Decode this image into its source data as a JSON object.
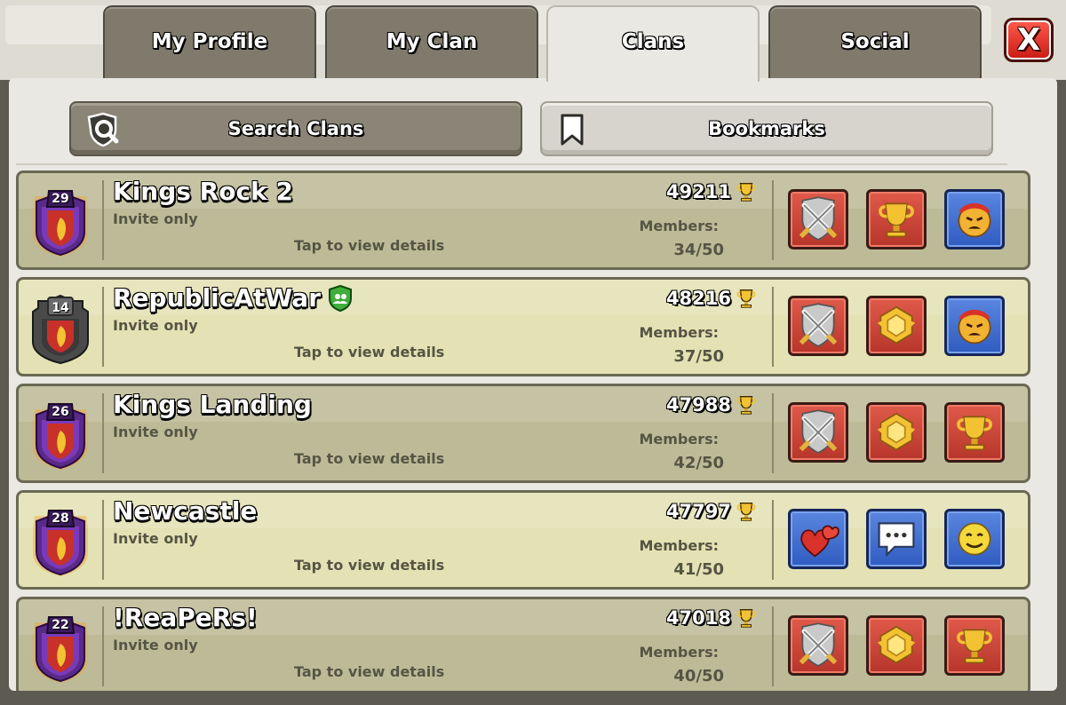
{
  "tabs": [
    {
      "label": "My Profile",
      "active": false
    },
    {
      "label": "My Clan",
      "active": false
    },
    {
      "label": "Clans",
      "active": true
    },
    {
      "label": "Social",
      "active": false
    }
  ],
  "close_label": "X",
  "subnav": {
    "search_label": "Search Clans",
    "bookmarks_label": "Bookmarks"
  },
  "clans": [
    {
      "name": "Kings Rock 2",
      "level": "29",
      "status": "Invite only",
      "details": "Tap to view details",
      "trophies": "49211",
      "members_label": "Members:",
      "members": "34/50",
      "badge_style": "purple",
      "verified": false,
      "labels": [
        {
          "icon": "crossed-swords-icon",
          "color": "red"
        },
        {
          "icon": "trophy-icon",
          "color": "red"
        },
        {
          "icon": "angry-face-icon",
          "color": "blue"
        }
      ]
    },
    {
      "name": "RepublicAtWar",
      "level": "14",
      "status": "Invite only",
      "details": "Tap to view details",
      "trophies": "48216",
      "members_label": "Members:",
      "members": "37/50",
      "badge_style": "gray",
      "verified": true,
      "labels": [
        {
          "icon": "crossed-swords-icon",
          "color": "red"
        },
        {
          "icon": "clan-games-icon",
          "color": "red"
        },
        {
          "icon": "angry-face-icon",
          "color": "blue"
        }
      ]
    },
    {
      "name": "Kings Landing",
      "level": "26",
      "status": "Invite only",
      "details": "Tap to view details",
      "trophies": "47988",
      "members_label": "Members:",
      "members": "42/50",
      "badge_style": "purple",
      "verified": false,
      "labels": [
        {
          "icon": "crossed-swords-icon",
          "color": "red"
        },
        {
          "icon": "clan-games-icon",
          "color": "red"
        },
        {
          "icon": "trophy-icon",
          "color": "red"
        }
      ]
    },
    {
      "name": "Newcastle",
      "level": "28",
      "status": "Invite only",
      "details": "Tap to view details",
      "trophies": "47797",
      "members_label": "Members:",
      "members": "41/50",
      "badge_style": "purple",
      "verified": false,
      "labels": [
        {
          "icon": "hearts-icon",
          "color": "blue"
        },
        {
          "icon": "chat-bubble-icon",
          "color": "blue"
        },
        {
          "icon": "smiley-face-icon",
          "color": "blue"
        }
      ]
    },
    {
      "name": "!ReaPeRs!",
      "level": "22",
      "status": "Invite only",
      "details": "Tap to view details",
      "trophies": "47018",
      "members_label": "Members:",
      "members": "40/50",
      "badge_style": "purple",
      "verified": false,
      "labels": [
        {
          "icon": "crossed-swords-icon",
          "color": "red"
        },
        {
          "icon": "clan-games-icon",
          "color": "red"
        },
        {
          "icon": "trophy-icon",
          "color": "red"
        }
      ]
    }
  ],
  "colors": {
    "row_dark": "#bdbb97",
    "row_light": "#e4e2b4",
    "close_red": "#e0342a",
    "trophy_gold": "#f2c232"
  }
}
